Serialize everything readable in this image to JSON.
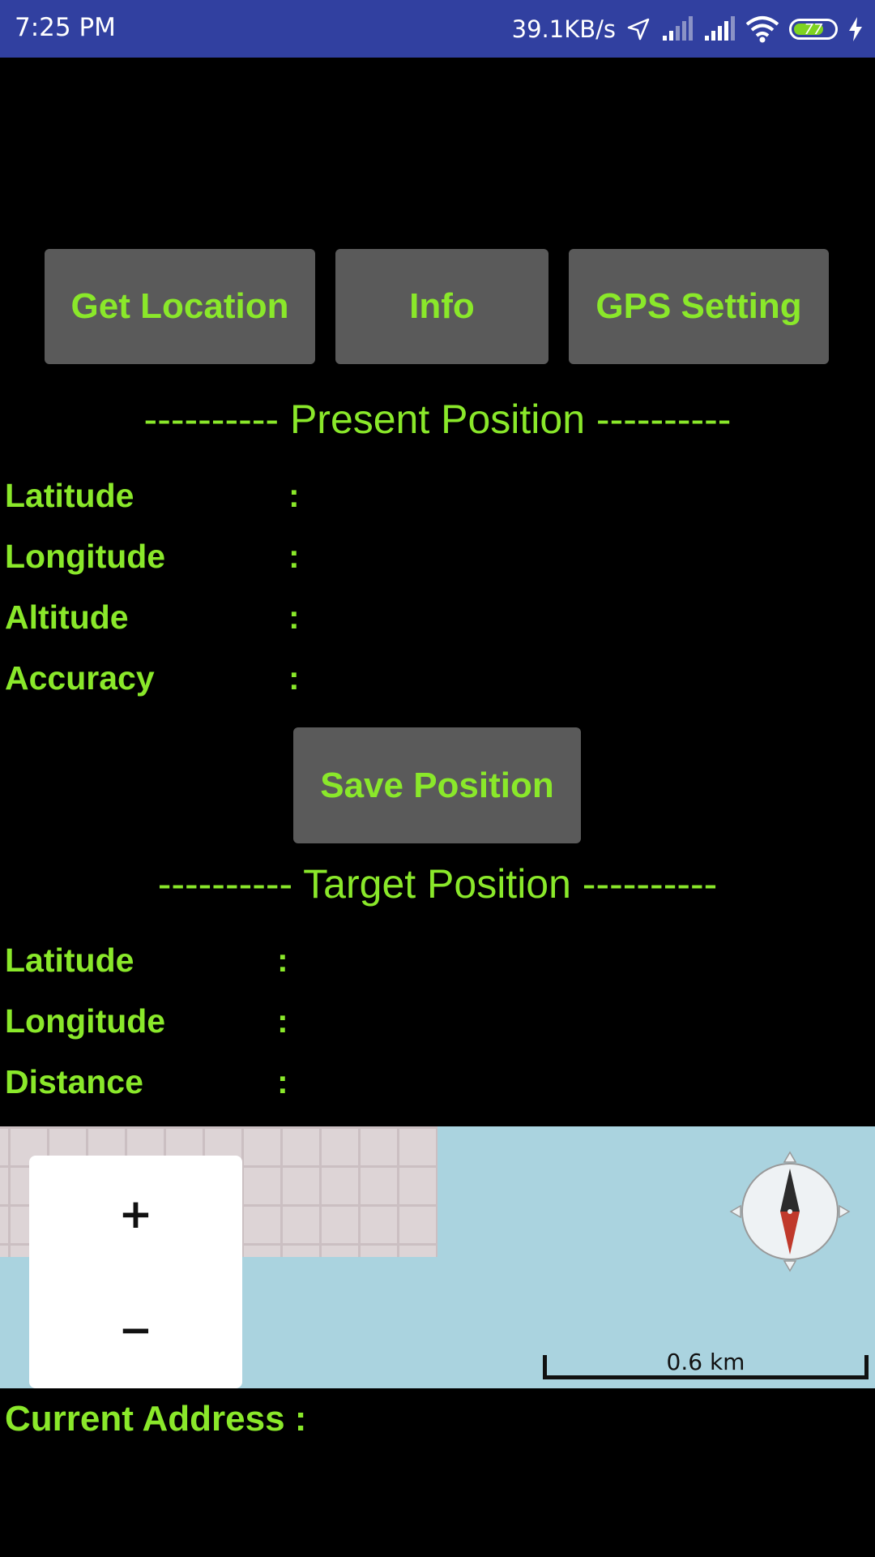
{
  "status_bar": {
    "time": "7:25 PM",
    "net_speed": "39.1KB/s",
    "battery_level": "77",
    "battery_percent": 77,
    "icons": [
      "location-arrow-icon",
      "signal-icon",
      "signal-icon",
      "wifi-icon",
      "battery-icon",
      "charging-icon"
    ]
  },
  "buttons": {
    "get_location": "Get Location",
    "info": "Info",
    "gps_setting": "GPS Setting",
    "save_position": "Save Position"
  },
  "present": {
    "title": "---------- Present Position ----------",
    "rows": [
      {
        "label": "Latitude",
        "sep": ":",
        "value": ""
      },
      {
        "label": "Longitude",
        "sep": ":",
        "value": ""
      },
      {
        "label": "Altitude",
        "sep": ":",
        "value": ""
      },
      {
        "label": "Accuracy",
        "sep": ":",
        "value": ""
      }
    ]
  },
  "target": {
    "title": "---------- Target Position ----------",
    "rows": [
      {
        "label": "Latitude",
        "sep": ":",
        "value": ""
      },
      {
        "label": "Longitude",
        "sep": ":",
        "value": ""
      },
      {
        "label": "Distance",
        "sep": ":",
        "value": ""
      }
    ]
  },
  "map": {
    "zoom_in": "+",
    "zoom_out": "−",
    "scale": "0.6 km"
  },
  "address": {
    "label": "Current Address :"
  },
  "colors": {
    "accent": "#8ae82a",
    "status_bar": "#3140a0",
    "button_bg": "#5a5a5a",
    "background": "#000000",
    "water": "#aad3df",
    "land": "#ddd4d6"
  }
}
